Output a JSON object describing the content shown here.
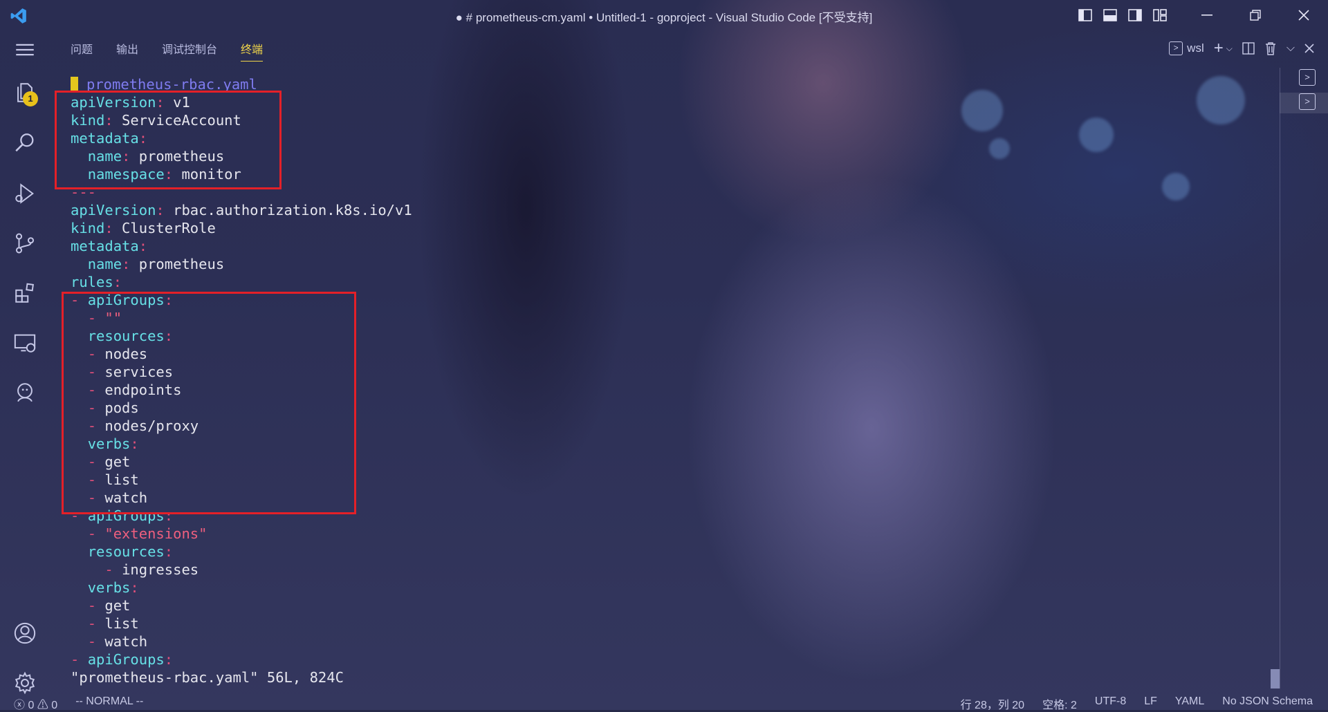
{
  "window": {
    "title": "● # prometheus-cm.yaml • Untitled-1 - goproject - Visual Studio Code [不受支持]"
  },
  "activity_bar": {
    "explorer_badge": "1",
    "items": [
      "explorer-icon",
      "search-icon",
      "run-debug-icon",
      "source-control-icon",
      "extensions-icon",
      "remote-explorer-icon",
      "jenkins-icon",
      "account-icon",
      "settings-gear-icon"
    ]
  },
  "panel": {
    "tabs": [
      {
        "label": "问题"
      },
      {
        "label": "输出"
      },
      {
        "label": "调试控制台"
      },
      {
        "label": "终端",
        "active": true
      }
    ],
    "terminal_profile": "wsl"
  },
  "terminal": {
    "filename": "prometheus-rbac.yaml",
    "lines": [
      {
        "i": "",
        "k": "apiVersion",
        "p": ":",
        "v": " v1"
      },
      {
        "i": "",
        "k": "kind",
        "p": ":",
        "v": " ServiceAccount"
      },
      {
        "i": "",
        "k": "metadata",
        "p": ":",
        "v": ""
      },
      {
        "i": "  ",
        "k": "name",
        "p": ":",
        "v": " prometheus"
      },
      {
        "i": "  ",
        "k": "namespace",
        "p": ":",
        "v": " monitor"
      },
      {
        "i": "",
        "k": "",
        "p": "---",
        "v": ""
      },
      {
        "i": "",
        "k": "apiVersion",
        "p": ":",
        "v": " rbac.authorization.k8s.io/v1"
      },
      {
        "i": "",
        "k": "kind",
        "p": ":",
        "v": " ClusterRole"
      },
      {
        "i": "",
        "k": "metadata",
        "p": ":",
        "v": ""
      },
      {
        "i": "  ",
        "k": "name",
        "p": ":",
        "v": " prometheus"
      },
      {
        "i": "",
        "k": "rules",
        "p": ":",
        "v": ""
      },
      {
        "i": "",
        "d": "- ",
        "k": "apiGroups",
        "p": ":",
        "v": ""
      },
      {
        "i": "  ",
        "d": "- ",
        "s": "\"\""
      },
      {
        "i": "  ",
        "k": "resources",
        "p": ":",
        "v": ""
      },
      {
        "i": "  ",
        "d": "- ",
        "v": "nodes"
      },
      {
        "i": "  ",
        "d": "- ",
        "v": "services"
      },
      {
        "i": "  ",
        "d": "- ",
        "v": "endpoints"
      },
      {
        "i": "  ",
        "d": "- ",
        "v": "pods"
      },
      {
        "i": "  ",
        "d": "- ",
        "v": "nodes/proxy"
      },
      {
        "i": "  ",
        "k": "verbs",
        "p": ":",
        "v": ""
      },
      {
        "i": "  ",
        "d": "- ",
        "v": "get"
      },
      {
        "i": "  ",
        "d": "- ",
        "v": "list"
      },
      {
        "i": "  ",
        "d": "- ",
        "v": "watch"
      },
      {
        "i": "",
        "d": "- ",
        "k": "apiGroups",
        "p": ":",
        "v": ""
      },
      {
        "i": "  ",
        "d": "- ",
        "s": "\"extensions\""
      },
      {
        "i": "  ",
        "k": "resources",
        "p": ":",
        "v": ""
      },
      {
        "i": "    ",
        "d": "- ",
        "v": "ingresses"
      },
      {
        "i": "  ",
        "k": "verbs",
        "p": ":",
        "v": ""
      },
      {
        "i": "  ",
        "d": "- ",
        "v": "get"
      },
      {
        "i": "  ",
        "d": "- ",
        "v": "list"
      },
      {
        "i": "  ",
        "d": "- ",
        "v": "watch"
      },
      {
        "i": "",
        "d": "- ",
        "k": "apiGroups",
        "p": ":",
        "v": ""
      }
    ],
    "vim_status": "\"prometheus-rbac.yaml\" 56L, 824C"
  },
  "statusbar": {
    "errors": "0",
    "warnings": "0",
    "mode": "-- NORMAL --",
    "position": "行 28，列 20",
    "spaces": "空格: 2",
    "encoding": "UTF-8",
    "eol": "LF",
    "language": "YAML",
    "schema": "No JSON Schema"
  }
}
